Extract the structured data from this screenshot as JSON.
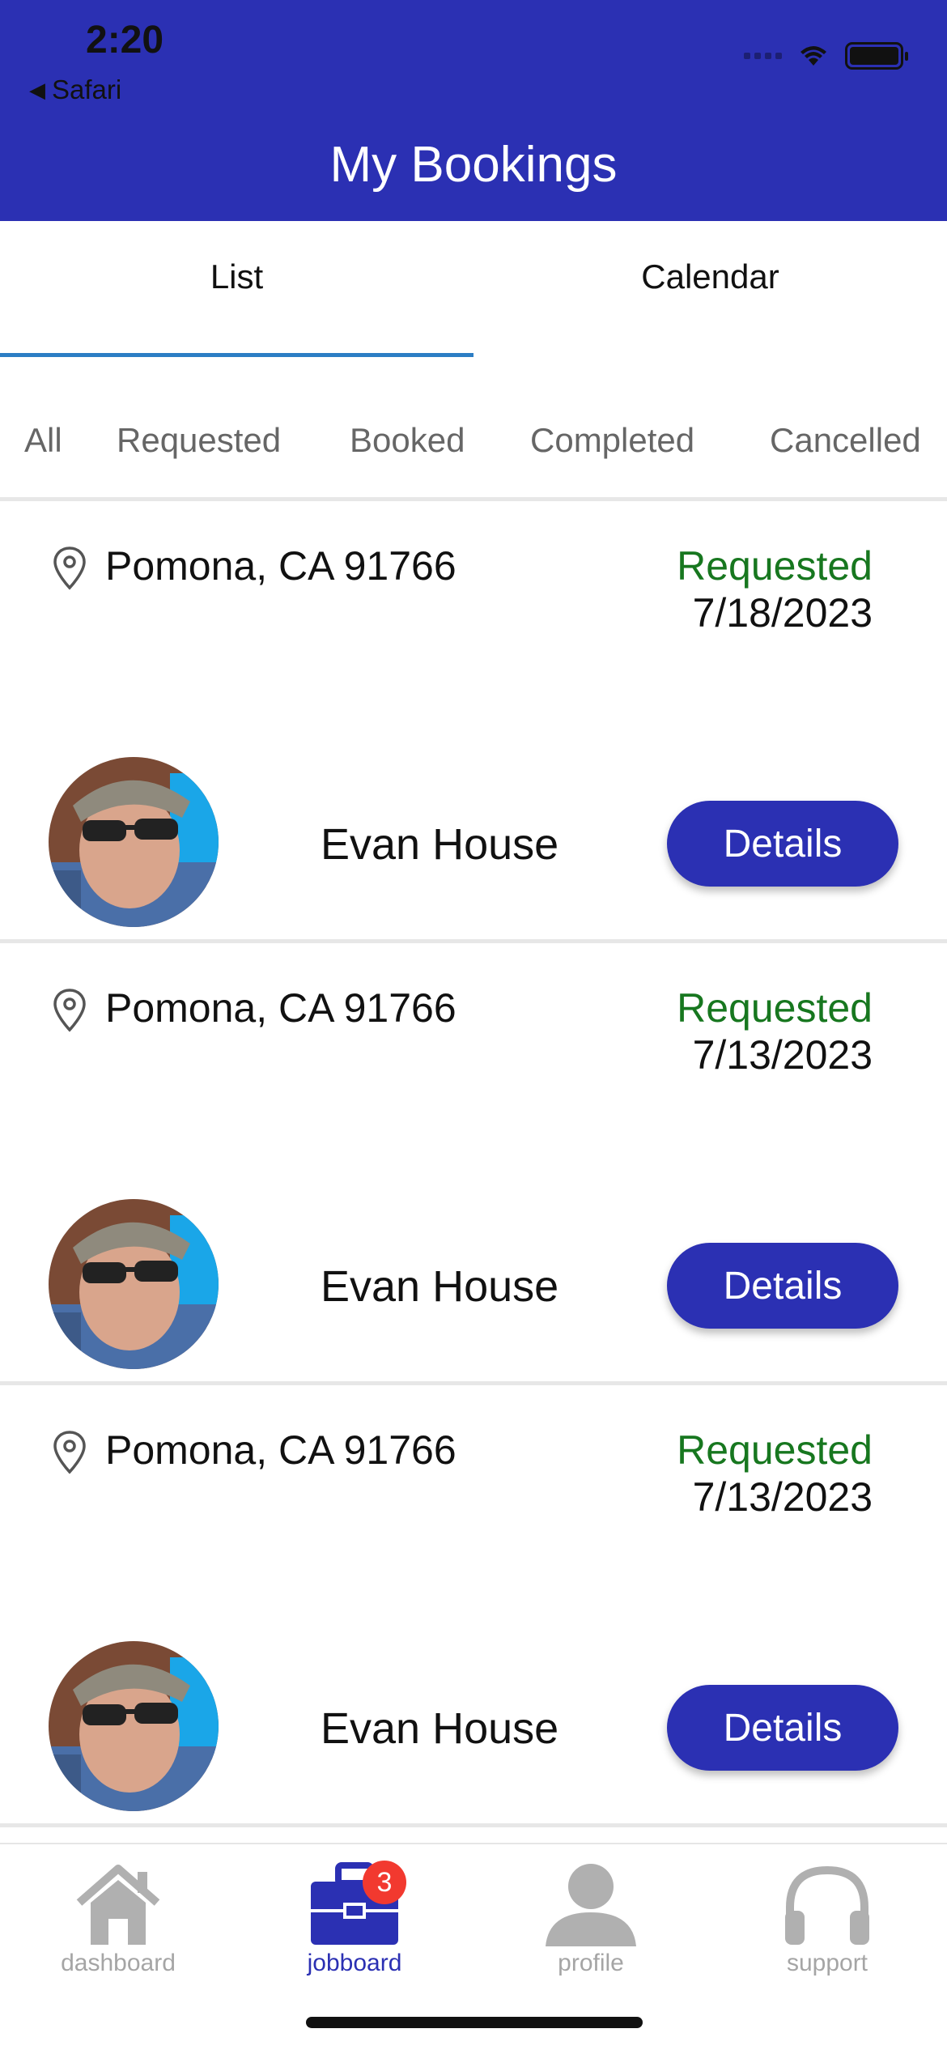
{
  "status_bar": {
    "time": "2:20",
    "back_label": "Safari"
  },
  "header": {
    "title": "My Bookings"
  },
  "tabs": [
    {
      "label": "List",
      "active": true
    },
    {
      "label": "Calendar",
      "active": false
    }
  ],
  "filters": [
    "All",
    "Requested",
    "Booked",
    "Completed",
    "Cancelled"
  ],
  "bookings": [
    {
      "location": "Pomona, CA 91766",
      "status": "Requested",
      "date": "7/18/2023",
      "name": "Evan House",
      "button": "Details"
    },
    {
      "location": "Pomona, CA 91766",
      "status": "Requested",
      "date": "7/13/2023",
      "name": "Evan House",
      "button": "Details"
    },
    {
      "location": "Pomona, CA 91766",
      "status": "Requested",
      "date": "7/13/2023",
      "name": "Evan House",
      "button": "Details"
    }
  ],
  "bottom_nav": [
    {
      "label": "dashboard",
      "icon": "house-icon",
      "active": false
    },
    {
      "label": "jobboard",
      "icon": "briefcase-icon",
      "active": true,
      "badge": "3"
    },
    {
      "label": "profile",
      "icon": "person-icon",
      "active": false
    },
    {
      "label": "support",
      "icon": "headphones-icon",
      "active": false
    }
  ],
  "colors": {
    "primary": "#2b30b3",
    "status_requested": "#17771f",
    "tab_underline": "#2c7dc4",
    "badge": "#f2392f",
    "inactive": "#a5a5a5"
  }
}
